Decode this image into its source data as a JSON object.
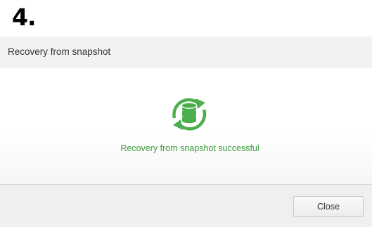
{
  "step_label": "4.",
  "dialog": {
    "title": "Recovery from snapshot",
    "status_icon": "database-recovery-icon",
    "status_message": "Recovery from snapshot successful",
    "close_label": "Close"
  },
  "colors": {
    "success": "#3a9a3a",
    "icon_green": "#4cae4c",
    "header_bg": "#f2f2f2",
    "footer_bg": "#efefef"
  }
}
